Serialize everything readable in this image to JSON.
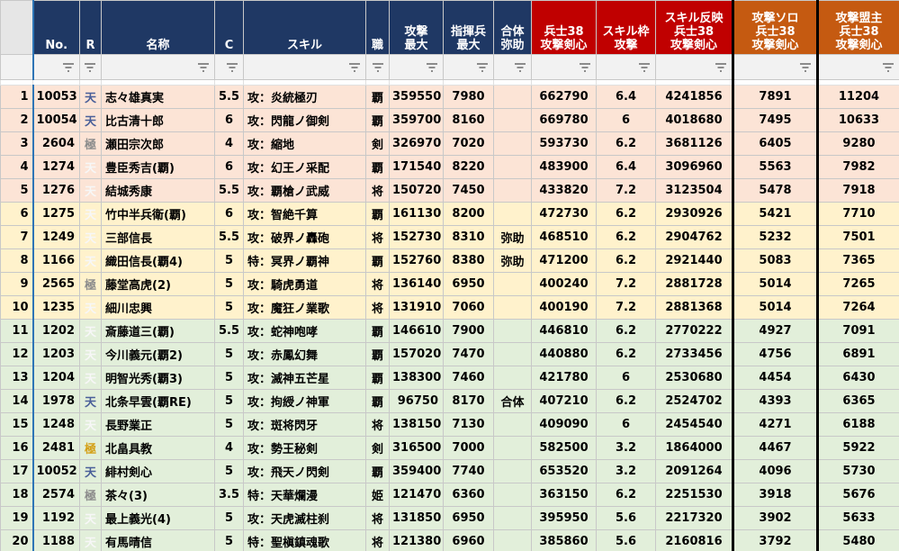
{
  "headers": {
    "no": "No.",
    "r": "R",
    "name": "名称",
    "c": "C",
    "skill": "スキル",
    "job": "職",
    "atk_max": "攻撃\n最大",
    "cmd_max": "指揮兵\n最大",
    "combo": "合体\n弥助",
    "soldier38": "兵士38\n攻撃剣心",
    "skill_slot": "スキル枠\n攻撃",
    "skill_reflect": "スキル反映\n兵士38\n攻撃剣心",
    "atk_solo": "攻撃ソロ\n兵士38\n攻撃剣心",
    "atk_ally": "攻撃盟主\n兵士38\n攻撃剣心"
  },
  "colors": {
    "header_blue": "#1f3864",
    "header_red": "#c00000",
    "header_orange": "#c55a11",
    "row_peach": "#fce4d6",
    "row_cream": "#fff2cc",
    "row_green": "#e2efda"
  },
  "rows": [
    {
      "row": "1",
      "no": "10053",
      "r": "天",
      "rc": "blue",
      "name": "志々雄真実",
      "c": "5.5",
      "skill": "攻：炎統極刃",
      "job": "覇",
      "atk": "359550",
      "cmd": "7980",
      "combo": "",
      "s38": "662790",
      "slot": "6.4",
      "ref": "4241856",
      "solo": "7891",
      "ally": "11204",
      "band": "peach"
    },
    {
      "row": "2",
      "no": "10054",
      "r": "天",
      "rc": "blue",
      "name": "比古清十郎",
      "c": "6",
      "skill": "攻：閃龍ノ御剣",
      "job": "覇",
      "atk": "359700",
      "cmd": "8160",
      "combo": "",
      "s38": "669780",
      "slot": "6",
      "ref": "4018680",
      "solo": "7495",
      "ally": "10633",
      "band": "peach"
    },
    {
      "row": "3",
      "no": "2604",
      "r": "極",
      "rc": "gray",
      "name": "瀬田宗次郎",
      "c": "4",
      "skill": "攻：縮地",
      "job": "剣",
      "atk": "326970",
      "cmd": "7020",
      "combo": "",
      "s38": "593730",
      "slot": "6.2",
      "ref": "3681126",
      "solo": "6405",
      "ally": "9280",
      "band": "peach"
    },
    {
      "row": "4",
      "no": "1274",
      "r": "天",
      "rc": "white",
      "name": "豊臣秀吉(覇)",
      "c": "6",
      "skill": "攻：幻王ノ采配",
      "job": "覇",
      "atk": "171540",
      "cmd": "8220",
      "combo": "",
      "s38": "483900",
      "slot": "6.4",
      "ref": "3096960",
      "solo": "5563",
      "ally": "7982",
      "band": "peach"
    },
    {
      "row": "5",
      "no": "1276",
      "r": "天",
      "rc": "white",
      "name": "結城秀康",
      "c": "5.5",
      "skill": "攻：覇槍ノ武威",
      "job": "将",
      "atk": "150720",
      "cmd": "7450",
      "combo": "",
      "s38": "433820",
      "slot": "7.2",
      "ref": "3123504",
      "solo": "5478",
      "ally": "7918",
      "band": "peach"
    },
    {
      "row": "6",
      "no": "1275",
      "r": "天",
      "rc": "white",
      "name": "竹中半兵衛(覇)",
      "c": "6",
      "skill": "攻：智絶千算",
      "job": "覇",
      "atk": "161130",
      "cmd": "8200",
      "combo": "",
      "s38": "472730",
      "slot": "6.2",
      "ref": "2930926",
      "solo": "5421",
      "ally": "7710",
      "band": "cream"
    },
    {
      "row": "7",
      "no": "1249",
      "r": "天",
      "rc": "white",
      "name": "三部信長",
      "c": "5.5",
      "skill": "攻：破界ノ轟砲",
      "job": "将",
      "atk": "152730",
      "cmd": "8310",
      "combo": "弥助",
      "s38": "468510",
      "slot": "6.2",
      "ref": "2904762",
      "solo": "5232",
      "ally": "7501",
      "band": "cream"
    },
    {
      "row": "8",
      "no": "1166",
      "r": "天",
      "rc": "white",
      "name": "織田信長(覇4)",
      "c": "5",
      "skill": "特：冥界ノ覇神",
      "job": "覇",
      "atk": "152760",
      "cmd": "8380",
      "combo": "弥助",
      "s38": "471200",
      "slot": "6.2",
      "ref": "2921440",
      "solo": "5083",
      "ally": "7365",
      "band": "cream"
    },
    {
      "row": "9",
      "no": "2565",
      "r": "極",
      "rc": "gray",
      "name": "藤堂高虎(2)",
      "c": "5",
      "skill": "攻：騎虎勇道",
      "job": "将",
      "atk": "136140",
      "cmd": "6950",
      "combo": "",
      "s38": "400240",
      "slot": "7.2",
      "ref": "2881728",
      "solo": "5014",
      "ally": "7265",
      "band": "cream"
    },
    {
      "row": "10",
      "no": "1235",
      "r": "天",
      "rc": "white",
      "name": "細川忠興",
      "c": "5",
      "skill": "攻：魔狂ノ業歌",
      "job": "将",
      "atk": "131910",
      "cmd": "7060",
      "combo": "",
      "s38": "400190",
      "slot": "7.2",
      "ref": "2881368",
      "solo": "5014",
      "ally": "7264",
      "band": "cream"
    },
    {
      "row": "11",
      "no": "1202",
      "r": "天",
      "rc": "white",
      "name": "斎藤道三(覇)",
      "c": "5.5",
      "skill": "攻：蛇神咆哮",
      "job": "覇",
      "atk": "146610",
      "cmd": "7900",
      "combo": "",
      "s38": "446810",
      "slot": "6.2",
      "ref": "2770222",
      "solo": "4927",
      "ally": "7091",
      "band": "green"
    },
    {
      "row": "12",
      "no": "1203",
      "r": "天",
      "rc": "white",
      "name": "今川義元(覇2)",
      "c": "5",
      "skill": "攻：赤鳳幻舞",
      "job": "覇",
      "atk": "157020",
      "cmd": "7470",
      "combo": "",
      "s38": "440880",
      "slot": "6.2",
      "ref": "2733456",
      "solo": "4756",
      "ally": "6891",
      "band": "green"
    },
    {
      "row": "13",
      "no": "1204",
      "r": "天",
      "rc": "white",
      "name": "明智光秀(覇3)",
      "c": "5",
      "skill": "攻：滅神五芒星",
      "job": "覇",
      "atk": "138300",
      "cmd": "7460",
      "combo": "",
      "s38": "421780",
      "slot": "6",
      "ref": "2530680",
      "solo": "4454",
      "ally": "6430",
      "band": "green"
    },
    {
      "row": "14",
      "no": "1978",
      "r": "天",
      "rc": "blue",
      "name": "北条早雲(覇RE)",
      "c": "5",
      "skill": "攻：拘綬ノ神軍",
      "job": "覇",
      "atk": "96750",
      "cmd": "8170",
      "combo": "合体",
      "s38": "407210",
      "slot": "6.2",
      "ref": "2524702",
      "solo": "4393",
      "ally": "6365",
      "band": "green"
    },
    {
      "row": "15",
      "no": "1248",
      "r": "天",
      "rc": "white",
      "name": "長野業正",
      "c": "5",
      "skill": "攻：斑将閃牙",
      "job": "将",
      "atk": "138150",
      "cmd": "7130",
      "combo": "",
      "s38": "409090",
      "slot": "6",
      "ref": "2454540",
      "solo": "4271",
      "ally": "6188",
      "band": "green"
    },
    {
      "row": "16",
      "no": "2481",
      "r": "極",
      "rc": "gold",
      "name": "北畠具教",
      "c": "4",
      "skill": "攻：勢王秘剣",
      "job": "剣",
      "atk": "316500",
      "cmd": "7000",
      "combo": "",
      "s38": "582500",
      "slot": "3.2",
      "ref": "1864000",
      "solo": "4467",
      "ally": "5922",
      "band": "green"
    },
    {
      "row": "17",
      "no": "10052",
      "r": "天",
      "rc": "blue",
      "name": "緋村剣心",
      "c": "5",
      "skill": "攻：飛天ノ閃剣",
      "job": "覇",
      "atk": "359400",
      "cmd": "7740",
      "combo": "",
      "s38": "653520",
      "slot": "3.2",
      "ref": "2091264",
      "solo": "4096",
      "ally": "5730",
      "band": "green"
    },
    {
      "row": "18",
      "no": "2574",
      "r": "極",
      "rc": "gray",
      "name": "茶々(3)",
      "c": "3.5",
      "skill": "特：天華爛漫",
      "job": "姫",
      "atk": "121470",
      "cmd": "6360",
      "combo": "",
      "s38": "363150",
      "slot": "6.2",
      "ref": "2251530",
      "solo": "3918",
      "ally": "5676",
      "band": "green"
    },
    {
      "row": "19",
      "no": "1192",
      "r": "天",
      "rc": "white",
      "name": "最上義光(4)",
      "c": "5",
      "skill": "攻：天虎滅柱刹",
      "job": "将",
      "atk": "131850",
      "cmd": "6950",
      "combo": "",
      "s38": "395950",
      "slot": "5.6",
      "ref": "2217320",
      "solo": "3902",
      "ally": "5633",
      "band": "green"
    },
    {
      "row": "20",
      "no": "1188",
      "r": "天",
      "rc": "white",
      "name": "有馬晴信",
      "c": "5",
      "skill": "特：聖槇鎮魂歌",
      "job": "将",
      "atk": "121380",
      "cmd": "6960",
      "combo": "",
      "s38": "385860",
      "slot": "5.6",
      "ref": "2160816",
      "solo": "3792",
      "ally": "5480",
      "band": "green"
    }
  ]
}
